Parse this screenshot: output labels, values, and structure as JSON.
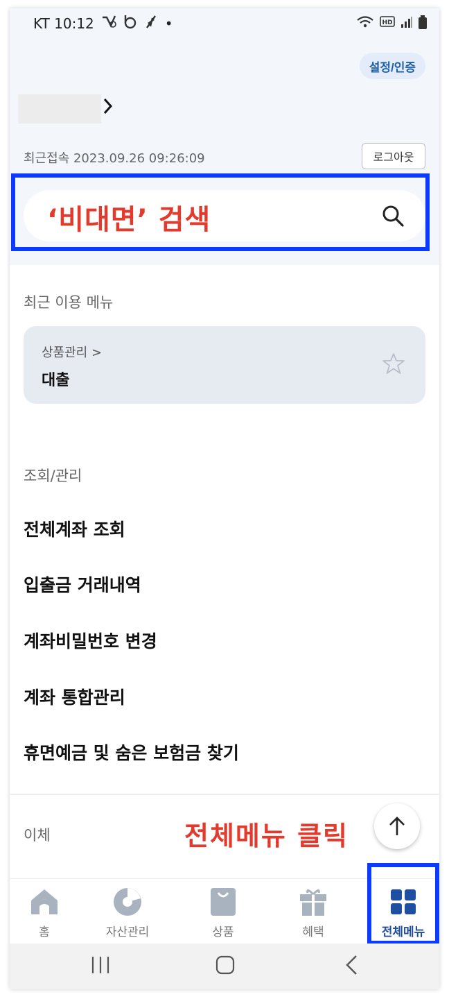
{
  "status_bar": {
    "carrier_time": "KT 10:12",
    "dot": "•"
  },
  "header": {
    "settings_label": "설정/인증",
    "last_login_label": "최근접속",
    "last_login_value": "2023.09.26 09:26:09",
    "logout_label": "로그아웃"
  },
  "search": {
    "annotation_text": "‘비대면’ 검색"
  },
  "recent": {
    "section_label": "최근 이용 메뉴",
    "card_path": "상품관리 >",
    "card_title": "대출"
  },
  "inquiry": {
    "section_label": "조회/관리",
    "items": [
      {
        "label": "전체계좌 조회"
      },
      {
        "label": "입출금 거래내역"
      },
      {
        "label": "계좌비밀번호 변경"
      },
      {
        "label": "계좌 통합관리"
      },
      {
        "label": "휴면예금 및 숨은 보험금 찾기"
      }
    ]
  },
  "transfer": {
    "section_label": "이체"
  },
  "annotation": {
    "all_menu_click": "전체메뉴 클릭"
  },
  "bottom_nav": {
    "items": [
      {
        "label": "홈",
        "icon": "home-icon"
      },
      {
        "label": "자산관리",
        "icon": "pie-chart-icon"
      },
      {
        "label": "상품",
        "icon": "shopping-bag-icon"
      },
      {
        "label": "혜택",
        "icon": "gift-icon"
      },
      {
        "label": "전체메뉴",
        "icon": "grid-icon"
      }
    ],
    "active_index": 4,
    "active_color": "#1f4fa0"
  },
  "colors": {
    "annotation_red": "#e23a2c",
    "highlight_blue": "#0a3bff",
    "header_bg": "#f3f6fb"
  }
}
